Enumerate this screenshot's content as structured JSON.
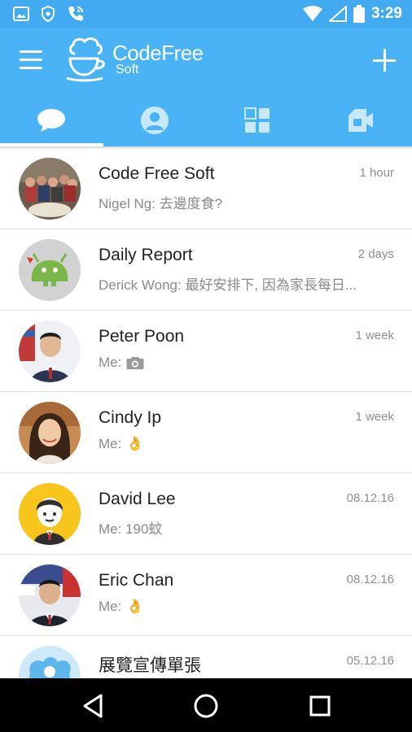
{
  "status_bar": {
    "time": "3:29"
  },
  "app_bar": {
    "logo_title": "CodeFree",
    "logo_subtitle": "Soft"
  },
  "conversations": [
    {
      "name": "Code Free Soft",
      "time": "1 hour",
      "preview": "Nigel Ng: 去邊度食?"
    },
    {
      "name": "Daily Report",
      "time": "2 days",
      "preview": "Derick Wong: 最好安排下, 因為家長每日..."
    },
    {
      "name": "Peter Poon",
      "time": "1 week",
      "preview": "Me:",
      "attachment_icon": "camera-icon"
    },
    {
      "name": "Cindy Ip",
      "time": "1 week",
      "preview": "Me:",
      "emoji": "👌"
    },
    {
      "name": "David Lee",
      "time": "08.12.16",
      "preview": "Me: 190蚊"
    },
    {
      "name": "Eric Chan",
      "time": "08.12.16",
      "preview": "Me:",
      "emoji": "👌"
    },
    {
      "name": "展覽宣傳單張",
      "time": "05.12.16",
      "preview": ""
    }
  ],
  "colors": {
    "primary": "#49b3f5",
    "status_bar": "#42aaf0",
    "tab_indicator": "#ffffff",
    "emoji_yellow": "#f5b800"
  }
}
